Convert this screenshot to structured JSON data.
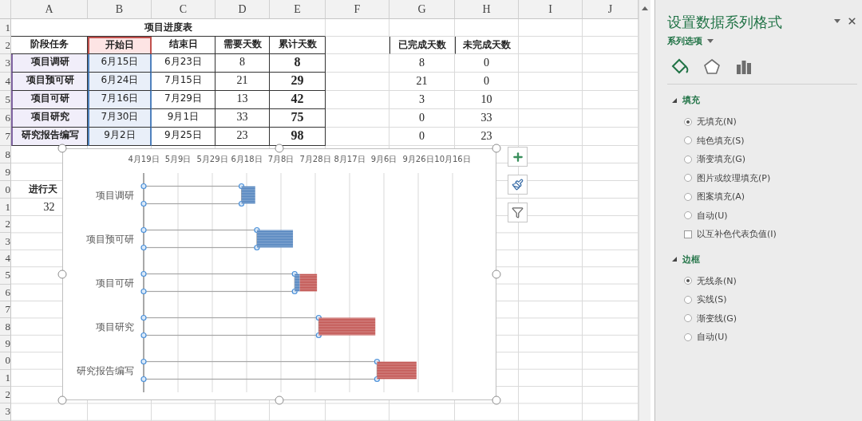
{
  "columns": [
    "A",
    "B",
    "C",
    "D",
    "E",
    "F",
    "G",
    "H",
    "I",
    "J"
  ],
  "row_numbers": [
    "1",
    "2",
    "3",
    "4",
    "5",
    "6",
    "7",
    "8",
    "9",
    "0",
    "1",
    "2",
    "3",
    "4",
    "5",
    "6",
    "7",
    "8",
    "9",
    "0",
    "1",
    "2",
    "3"
  ],
  "sheet_title": "项目进度表",
  "table": {
    "columns": [
      "阶段任务",
      "开始日",
      "结束日",
      "需要天数",
      "累计天数"
    ],
    "rows": [
      [
        "项目调研",
        "6月15日",
        "6月23日",
        "8",
        "8"
      ],
      [
        "项目预可研",
        "6月24日",
        "7月15日",
        "21",
        "29"
      ],
      [
        "项目可研",
        "7月16日",
        "7月29日",
        "13",
        "42"
      ],
      [
        "项目研究",
        "7月30日",
        "9月1日",
        "33",
        "75"
      ],
      [
        "研究报告编写",
        "9月2日",
        "9月25日",
        "23",
        "98"
      ]
    ]
  },
  "progress_table": {
    "columns": [
      "已完成天数",
      "未完成天数"
    ],
    "rows": [
      [
        "8",
        "0"
      ],
      [
        "21",
        "0"
      ],
      [
        "3",
        "10"
      ],
      [
        "0",
        "33"
      ],
      [
        "0",
        "23"
      ]
    ]
  },
  "days_label": "进行天",
  "days_value": "32",
  "chart": {
    "axis_labels": [
      "4月19日",
      "5月9日",
      "5月29日",
      "6月18日",
      "7月8日",
      "7月28日",
      "8月17日",
      "9月6日",
      "9月26日",
      "10月16日"
    ],
    "categories": [
      "项目调研",
      "项目预可研",
      "项目可研",
      "项目研究",
      "研究报告编写"
    ],
    "series_styles": [
      {
        "color": "#a6a6a6",
        "filled": false,
        "selected": true
      },
      {
        "color": "#4f81bd",
        "filled": true,
        "selected": false
      },
      {
        "color": "#c0504d",
        "filled": true,
        "selected": false
      }
    ]
  },
  "panel": {
    "title": "设置数据系列格式",
    "subtitle": "系列选项",
    "icon_tabs": [
      {
        "kind": "fill",
        "selected": true
      },
      {
        "kind": "effects",
        "selected": false
      },
      {
        "kind": "options",
        "selected": false
      }
    ],
    "sections": [
      {
        "title": "填充",
        "expanded": true,
        "options": [
          {
            "kind": "radio",
            "label": "无填充(N)",
            "selected": true
          },
          {
            "kind": "radio",
            "label": "纯色填充(S)",
            "selected": false
          },
          {
            "kind": "radio",
            "label": "渐变填充(G)",
            "selected": false
          },
          {
            "kind": "radio",
            "label": "图片或纹理填充(P)",
            "selected": false
          },
          {
            "kind": "radio",
            "label": "图案填充(A)",
            "selected": false
          },
          {
            "kind": "radio",
            "label": "自动(U)",
            "selected": false
          },
          {
            "kind": "checkbox",
            "label": "以互补色代表负值(I)",
            "checked": false
          }
        ]
      },
      {
        "title": "边框",
        "expanded": true,
        "options": [
          {
            "kind": "radio",
            "label": "无线条(N)",
            "selected": true
          },
          {
            "kind": "radio",
            "label": "实线(S)",
            "selected": false
          },
          {
            "kind": "radio",
            "label": "渐变线(G)",
            "selected": false
          },
          {
            "kind": "radio",
            "label": "自动(U)",
            "selected": false
          }
        ]
      }
    ]
  }
}
